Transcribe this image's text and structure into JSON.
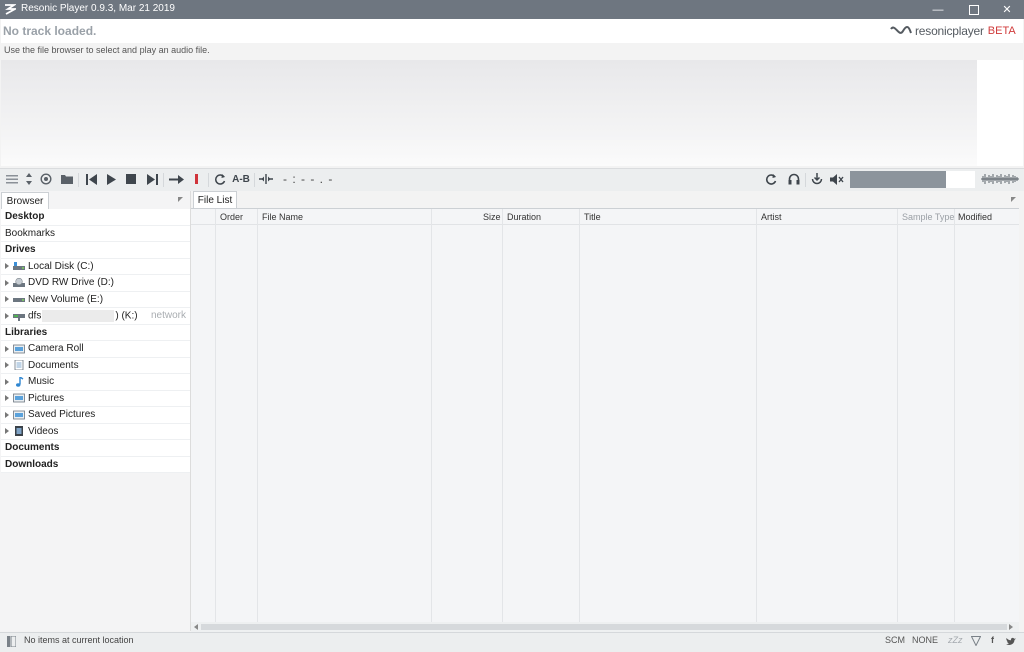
{
  "window": {
    "title": "Resonic Player 0.9.3, Mar 21 2019",
    "controls": [
      "minimize-icon",
      "maximize-icon",
      "close-icon"
    ]
  },
  "header": {
    "track_status": "No track loaded.",
    "hint": "Use the file browser to select and play an audio file.",
    "brand_name": "resonicplayer",
    "brand_badge": "BETA"
  },
  "toolbar": {
    "time_display": "- : - - . -",
    "ab_label": "A-B",
    "left_icons": [
      "menu-icon",
      "sort-updown-icon",
      "target-icon",
      "folder-icon",
      "skip-previous-icon",
      "play-icon",
      "stop-icon",
      "skip-next-icon",
      "continuous-play-icon",
      "record-marker-icon",
      "loop-icon",
      "ab-loop-icon",
      "center-icon"
    ],
    "right_icons": [
      "refresh-icon",
      "headphones-icon",
      "cue-icon",
      "mute-icon",
      "volume-slider",
      "waveform-mini-icon"
    ],
    "volume_level": 0.77
  },
  "browser": {
    "tab_label": "Browser",
    "items": [
      {
        "type": "header",
        "label": "Desktop"
      },
      {
        "type": "plain",
        "label": "Bookmarks"
      },
      {
        "type": "header",
        "label": "Drives"
      },
      {
        "type": "item",
        "label": "Local Disk (C:)",
        "icon": "disk-icon"
      },
      {
        "type": "item",
        "label": "DVD RW Drive (D:)",
        "icon": "dvd-drive-icon"
      },
      {
        "type": "item",
        "label": "New Volume (E:)",
        "icon": "drive-icon"
      },
      {
        "type": "item",
        "label": "dfs",
        "suffix": ") (K:)",
        "tag": "network",
        "icon": "network-drive-icon"
      },
      {
        "type": "header",
        "label": "Libraries"
      },
      {
        "type": "item",
        "label": "Camera Roll",
        "icon": "pictures-folder-icon"
      },
      {
        "type": "item",
        "label": "Documents",
        "icon": "documents-folder-icon"
      },
      {
        "type": "item",
        "label": "Music",
        "icon": "music-note-icon"
      },
      {
        "type": "item",
        "label": "Pictures",
        "icon": "pictures-folder-icon"
      },
      {
        "type": "item",
        "label": "Saved Pictures",
        "icon": "pictures-folder-icon"
      },
      {
        "type": "item",
        "label": "Videos",
        "icon": "videos-folder-icon"
      },
      {
        "type": "header",
        "label": "Documents"
      },
      {
        "type": "header",
        "label": "Downloads"
      }
    ]
  },
  "file_list": {
    "tab_label": "File List",
    "columns": [
      "Order",
      "File Name",
      "Size",
      "Duration",
      "Title",
      "Artist",
      "Sample Type",
      "Modified"
    ],
    "rows": []
  },
  "status": {
    "text": "No items at current location",
    "scm": "SCM",
    "mode": "NONE",
    "sleep": "zZz",
    "icons": [
      "filter-icon",
      "facebook-icon",
      "twitter-icon"
    ]
  }
}
